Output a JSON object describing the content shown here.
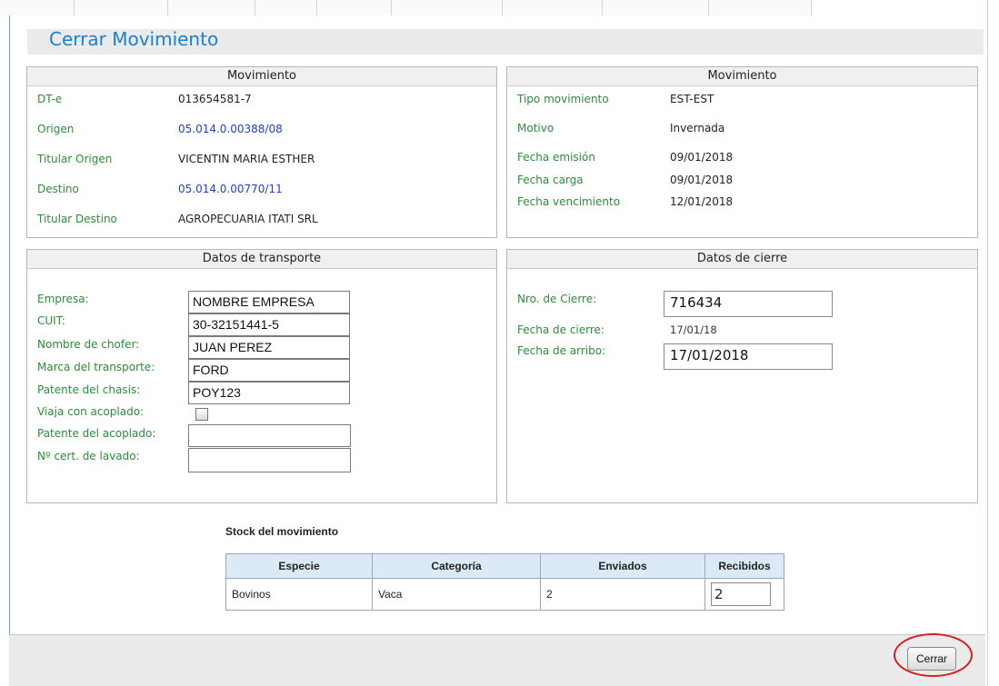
{
  "page": {
    "title": "Cerrar Movimiento"
  },
  "movimiento_left": {
    "header": "Movimiento",
    "rows": [
      {
        "label": "DT-e",
        "value": "013654581-7",
        "link": false
      },
      {
        "label": "Origen",
        "value": "05.014.0.00388/08",
        "link": true
      },
      {
        "label": "Titular Origen",
        "value": "VICENTIN MARIA ESTHER",
        "link": false
      },
      {
        "label": "Destino",
        "value": "05.014.0.00770/11",
        "link": true
      },
      {
        "label": "Titular Destino",
        "value": "AGROPECUARIA ITATI SRL",
        "link": false
      }
    ]
  },
  "movimiento_right": {
    "header": "Movimiento",
    "rows": [
      {
        "label": "Tipo movimiento",
        "value": "EST-EST"
      },
      {
        "label": "Motivo",
        "value": "Invernada"
      },
      {
        "label": "Fecha emisión",
        "value": "09/01/2018"
      },
      {
        "label": "Fecha carga",
        "value": "09/01/2018"
      },
      {
        "label": "Fecha vencimiento",
        "value": "12/01/2018"
      }
    ]
  },
  "transporte": {
    "header": "Datos de transporte",
    "empresa_label": "Empresa:",
    "empresa_value": "NOMBRE EMPRESA",
    "cuit_label": "CUIT:",
    "cuit_value": "30-32151441-5",
    "chofer_label": "Nombre de chofer:",
    "chofer_value": "JUAN PEREZ",
    "marca_label": "Marca del transporte:",
    "marca_value": "FORD",
    "patente_label": "Patente del chasis:",
    "patente_value": "POY123",
    "acoplado_label": "Viaja con acoplado:",
    "acoplado_checked": false,
    "patente_acoplado_label": "Patente del acoplado:",
    "patente_acoplado_value": "",
    "lavado_label": "Nº cert. de lavado:",
    "lavado_value": ""
  },
  "cierre": {
    "header": "Datos de cierre",
    "nro_label": "Nro. de Cierre:",
    "nro_value": "716434",
    "fecha_cierre_label": "Fecha de cierre:",
    "fecha_cierre_value": "17/01/18",
    "fecha_arribo_label": "Fecha de arribo:",
    "fecha_arribo_value": "17/01/2018"
  },
  "stock": {
    "title": "Stock del movimiento",
    "headers": [
      "Especie",
      "Categoría",
      "Enviados",
      "Recibidos"
    ],
    "row": {
      "especie": "Bovinos",
      "categoria": "Vaca",
      "enviados": "2",
      "recibidos": "2"
    }
  },
  "footer": {
    "cerrar_label": "Cerrar"
  },
  "colors": {
    "title": "#1a7fd6",
    "label": "#2e8b3a",
    "link": "#1f3fd0",
    "highlight_ring": "#d42020"
  }
}
